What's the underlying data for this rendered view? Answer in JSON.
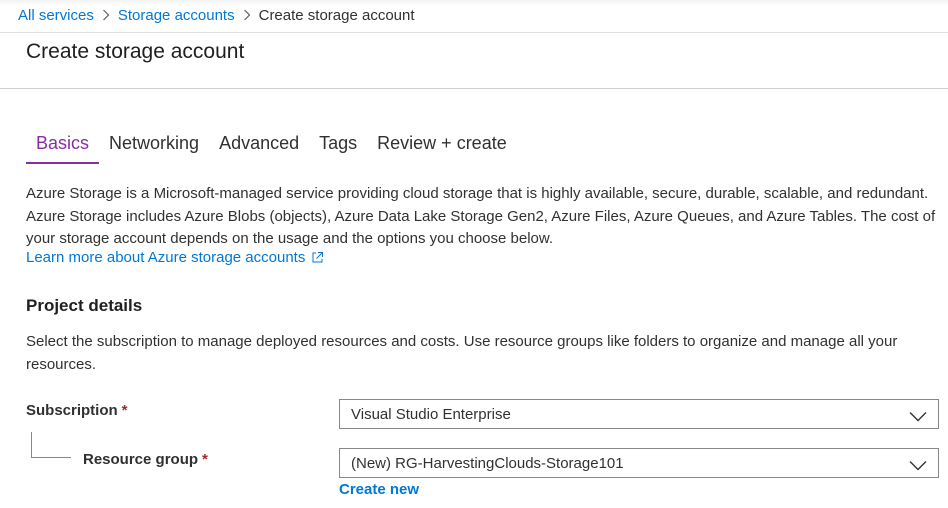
{
  "breadcrumb": {
    "items": [
      "All services",
      "Storage accounts"
    ],
    "current": "Create storage account"
  },
  "page_title": "Create storage account",
  "tabs": [
    {
      "label": "Basics",
      "active": true
    },
    {
      "label": "Networking",
      "active": false
    },
    {
      "label": "Advanced",
      "active": false
    },
    {
      "label": "Tags",
      "active": false
    },
    {
      "label": "Review + create",
      "active": false
    }
  ],
  "intro": {
    "text": "Azure Storage is a Microsoft-managed service providing cloud storage that is highly available, secure, durable, scalable, and redundant. Azure Storage includes Azure Blobs (objects), Azure Data Lake Storage Gen2, Azure Files, Azure Queues, and Azure Tables. The cost of your storage account depends on the usage and the options you choose below.",
    "link": "Learn more about Azure storage accounts"
  },
  "project_details": {
    "title": "Project details",
    "description": "Select the subscription to manage deployed resources and costs. Use resource groups like folders to organize and manage all your resources.",
    "subscription_label": "Subscription",
    "subscription_value": "Visual Studio Enterprise",
    "resource_group_label": "Resource group",
    "resource_group_value": "(New) RG-HarvestingClouds-Storage101",
    "create_new": "Create new",
    "required_marker": "*"
  },
  "icons": {
    "breadcrumb_separator": "chevron-right-icon",
    "external_link": "external-link-icon",
    "dropdown": "chevron-down-icon"
  },
  "colors": {
    "link": "#0078d4",
    "active_tab": "#8a2da5",
    "required": "#a4262c"
  }
}
